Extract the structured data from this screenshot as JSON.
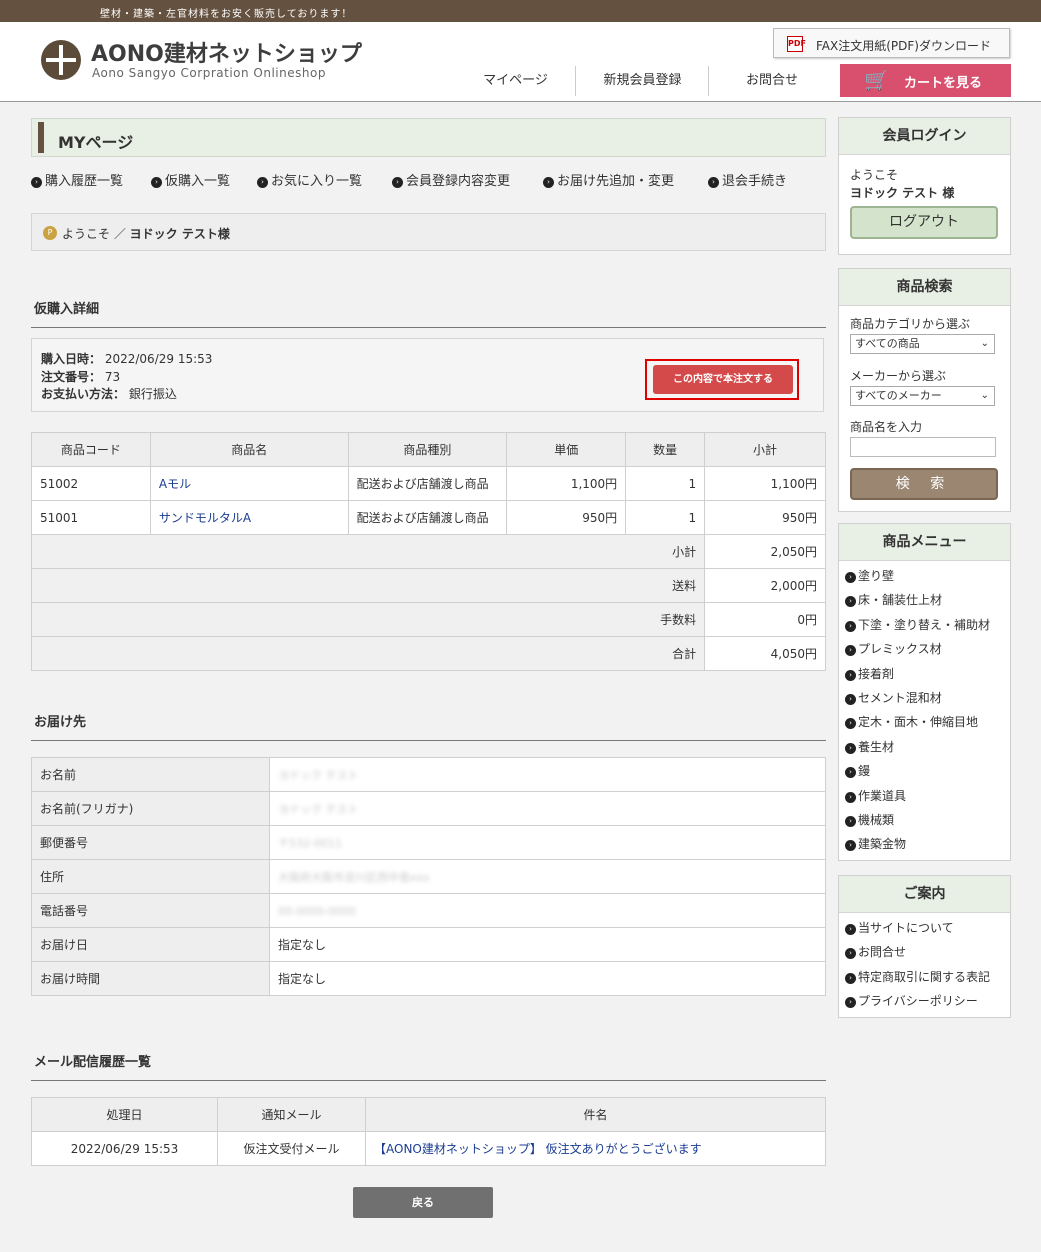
{
  "topbar": {
    "tagline": "壁材・建築・左官材料をお安く販売しております！"
  },
  "header": {
    "logo_title": "AONO建材ネットショップ",
    "logo_sub": "Aono Sangyo  Corpration  Onlineshop",
    "pdf_icon_text": "PDF",
    "fax_button": "FAX注文用紙(PDF)ダウンロード",
    "nav": {
      "mypage": "マイページ",
      "register": "新規会員登録",
      "contact": "お問合せ"
    },
    "cart_button": "カートを見る"
  },
  "main": {
    "page_title": "MYページ",
    "menu": [
      "購入履歴一覧",
      "仮購入一覧",
      "お気に入り一覧",
      "会員登録内容変更",
      "お届け先追加・変更",
      "退会手続き"
    ],
    "welcome_prefix": "ようこそ ／",
    "welcome_name": "ヨドック テスト様",
    "detail_title": "仮購入詳細",
    "order": {
      "date_label": "購入日時：",
      "date": "2022/06/29 15:53",
      "number_label": "注文番号：",
      "number": "73",
      "payment_label": "お支払い方法：",
      "payment": "銀行振込",
      "confirm_button": "この内容で本注文する"
    },
    "items_table": {
      "headers": [
        "商品コード",
        "商品名",
        "商品種別",
        "単価",
        "数量",
        "小計"
      ],
      "rows": [
        {
          "code": "51002",
          "name": "Aモル",
          "type": "配送および店舗渡し商品",
          "price": "1,100円",
          "qty": "1",
          "subtotal": "1,100円"
        },
        {
          "code": "51001",
          "name": "サンドモルタルA",
          "type": "配送および店舗渡し商品",
          "price": "950円",
          "qty": "1",
          "subtotal": "950円"
        }
      ],
      "summary": [
        {
          "label": "小計",
          "value": "2,050円"
        },
        {
          "label": "送料",
          "value": "2,000円"
        },
        {
          "label": "手数料",
          "value": "0円"
        },
        {
          "label": "合計",
          "value": "4,050円"
        }
      ]
    },
    "delivery_title": "お届け先",
    "delivery": [
      {
        "label": "お名前",
        "value": "ヨドック テスト"
      },
      {
        "label": "お名前(フリガナ)",
        "value": "ヨドック テスト"
      },
      {
        "label": "郵便番号",
        "value": "〒532-0011"
      },
      {
        "label": "住所",
        "value": "大阪府大阪市淀川区西中島xxx"
      },
      {
        "label": "電話番号",
        "value": "00-0000-0000"
      },
      {
        "label": "お届け日",
        "value": "指定なし"
      },
      {
        "label": "お届け時間",
        "value": "指定なし"
      }
    ],
    "mail_title": "メール配信履歴一覧",
    "mail_table": {
      "headers": [
        "処理日",
        "通知メール",
        "件名"
      ],
      "rows": [
        {
          "date": "2022/06/29 15:53",
          "type": "仮注文受付メール",
          "subject": "【AONO建材ネットショップ】 仮注文ありがとうございます"
        }
      ]
    },
    "back_button": "戻る"
  },
  "sidebar": {
    "login": {
      "title": "会員ログイン",
      "welcome": "ようこそ",
      "name": "ヨドック テスト 様",
      "logout": "ログアウト"
    },
    "search": {
      "title": "商品検索",
      "category_label": "商品カテゴリから選ぶ",
      "category_value": "すべての商品",
      "maker_label": "メーカーから選ぶ",
      "maker_value": "すべてのメーカー",
      "name_label": "商品名を入力",
      "button": "検 索"
    },
    "product_menu": {
      "title": "商品メニュー",
      "items": [
        "塗り壁",
        "床・舗装仕上材",
        "下塗・塗り替え・補助材",
        "プレミックス材",
        "接着剤",
        "セメント混和材",
        "定木・面木・伸縮目地",
        "養生材",
        "鏝",
        "作業道具",
        "機械類",
        "建築金物"
      ]
    },
    "info": {
      "title": "ご案内",
      "items": [
        "当サイトについて",
        "お問合せ",
        "特定商取引に関する表記",
        "プライバシーポリシー"
      ]
    }
  }
}
